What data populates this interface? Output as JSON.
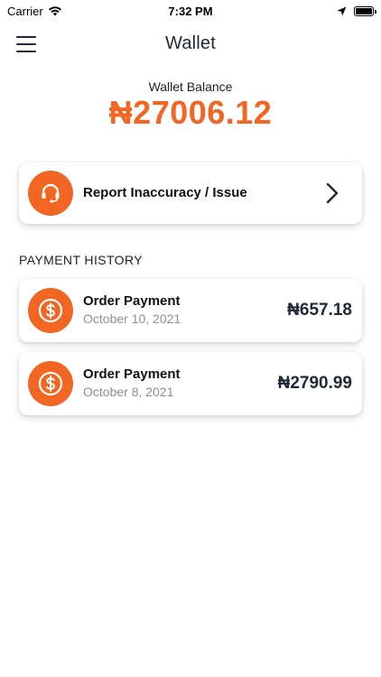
{
  "status_bar": {
    "carrier": "Carrier",
    "time": "7:32 PM"
  },
  "nav": {
    "title": "Wallet"
  },
  "balance": {
    "label": "Wallet Balance",
    "amount": "₦27006.12"
  },
  "report": {
    "label": "Report Inaccuracy / Issue"
  },
  "history": {
    "title": "PAYMENT HISTORY",
    "items": [
      {
        "title": "Order Payment",
        "date": "October 10, 2021",
        "amount": "₦657.18"
      },
      {
        "title": "Order Payment",
        "date": "October 8, 2021",
        "amount": "₦2790.99"
      }
    ]
  },
  "colors": {
    "accent": "#f26522",
    "text_dark": "#1f2937",
    "muted": "#8e8e93"
  },
  "icons": {
    "menu": "hamburger-menu-icon",
    "report": "headset-support-icon",
    "chevron": "chevron-right-icon",
    "payment": "dollar-coin-icon"
  }
}
